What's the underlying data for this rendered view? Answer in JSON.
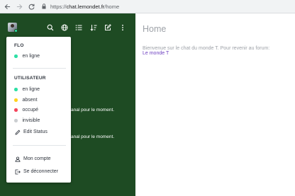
{
  "browser": {
    "url_scheme": "https://",
    "url_host": "chat.lemondet.fr",
    "url_path": "/home"
  },
  "sidebar": {
    "background": "#1e4b23",
    "fragment_line_1": "anal pour le moment.",
    "fragment_line_2": "anal pour le moment."
  },
  "main": {
    "title": "Home",
    "welcome_text": "Bienvenue sur le chat du monde T. Pour revenir au forum:",
    "link_text": "Le monde T",
    "link_color": "#6f42c1"
  },
  "user_menu": {
    "user_heading": "FLO",
    "current_status": {
      "label": "en ligne",
      "color": "#2de0a5"
    },
    "status_heading": "UTILISATEUR",
    "statuses": [
      {
        "label": "en ligne",
        "color": "#2de0a5"
      },
      {
        "label": "absent",
        "color": "#ffd21f"
      },
      {
        "label": "occupé",
        "color": "#f5455c"
      },
      {
        "label": "invisible",
        "color": "#cbced1"
      }
    ],
    "edit_status": "Edit Status",
    "my_account": "Mon compte",
    "logout": "Se déconnecter"
  }
}
